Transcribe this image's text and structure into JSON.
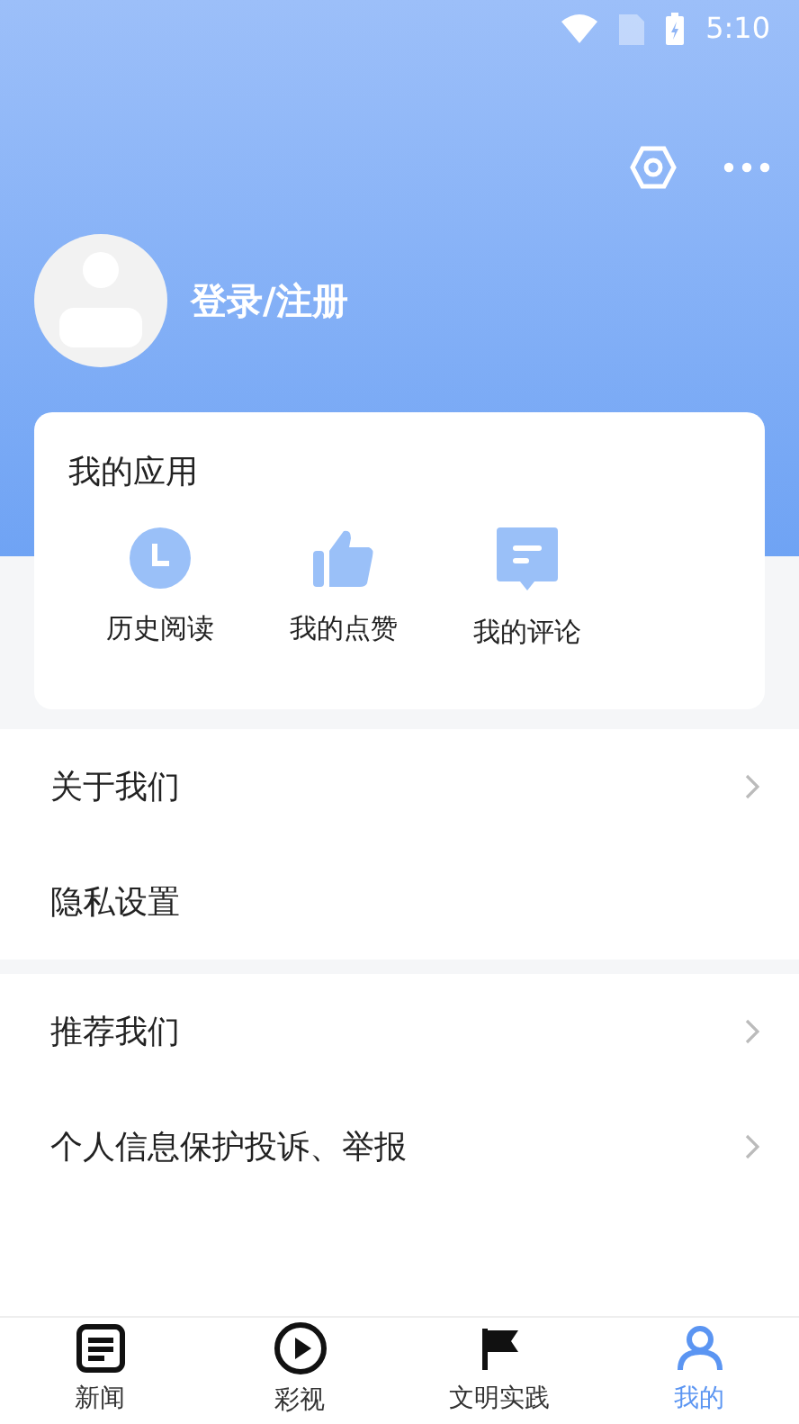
{
  "status_bar": {
    "time": "5:10"
  },
  "profile": {
    "login_label": "登录/注册"
  },
  "apps_card": {
    "title": "我的应用",
    "items": [
      {
        "label": "历史阅读",
        "kind": "clock"
      },
      {
        "label": "我的点赞",
        "kind": "thumb"
      },
      {
        "label": "我的评论",
        "kind": "comment"
      }
    ]
  },
  "menu_groups": [
    [
      {
        "label": "关于我们",
        "chevron": true
      },
      {
        "label": "隐私设置",
        "chevron": false
      }
    ],
    [
      {
        "label": "推荐我们",
        "chevron": true
      },
      {
        "label": "个人信息保护投诉、举报",
        "chevron": true
      }
    ]
  ],
  "tab_bar": [
    {
      "label": "新闻",
      "kind": "news",
      "selected": false
    },
    {
      "label": "彩视",
      "kind": "video",
      "selected": false
    },
    {
      "label": "文明实践",
      "kind": "practice",
      "selected": false
    },
    {
      "label": "我的",
      "kind": "me",
      "selected": true
    }
  ]
}
